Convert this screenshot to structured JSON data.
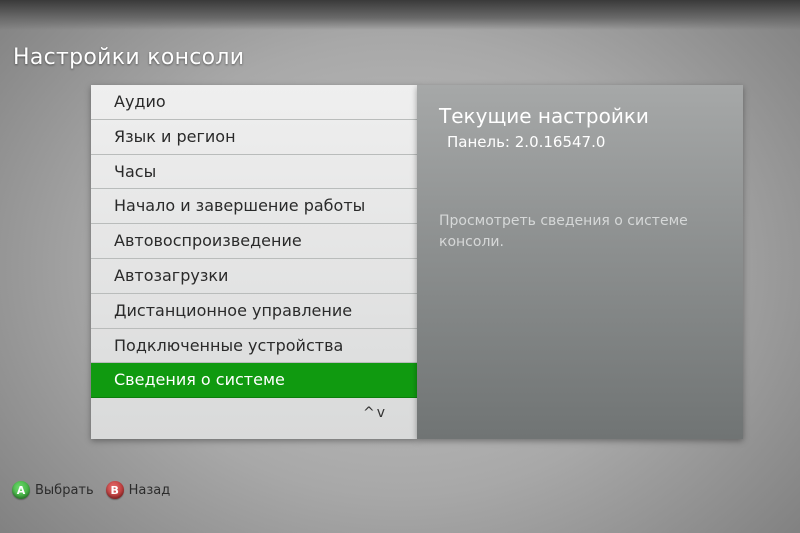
{
  "page_title": "Настройки консоли",
  "menu": {
    "items": [
      {
        "label": "Аудио",
        "selected": false
      },
      {
        "label": "Язык и регион",
        "selected": false
      },
      {
        "label": "Часы",
        "selected": false
      },
      {
        "label": "Начало и завершение работы",
        "selected": false
      },
      {
        "label": "Автовоспроизведение",
        "selected": false
      },
      {
        "label": "Автозагрузки",
        "selected": false
      },
      {
        "label": "Дистанционное управление",
        "selected": false
      },
      {
        "label": "Подключенные устройства",
        "selected": false
      },
      {
        "label": "Сведения о системе",
        "selected": true
      }
    ],
    "scroll_up_glyph": "^",
    "scroll_down_glyph": "v"
  },
  "info": {
    "title": "Текущие настройки",
    "version": "Панель: 2.0.16547.0",
    "description": "Просмотреть сведения о системе консоли."
  },
  "footer": {
    "select_button_letter": "A",
    "select_label": "Выбрать",
    "back_button_letter": "B",
    "back_label": "Назад"
  },
  "colors": {
    "selection_green": "#109a10",
    "a_button_green": "#2e9a2e",
    "b_button_red": "#a82222"
  },
  "icons": {
    "scroll_up": "chevron-up-icon",
    "scroll_down": "chevron-down-icon",
    "a_button": "a-button-icon",
    "b_button": "b-button-icon"
  }
}
